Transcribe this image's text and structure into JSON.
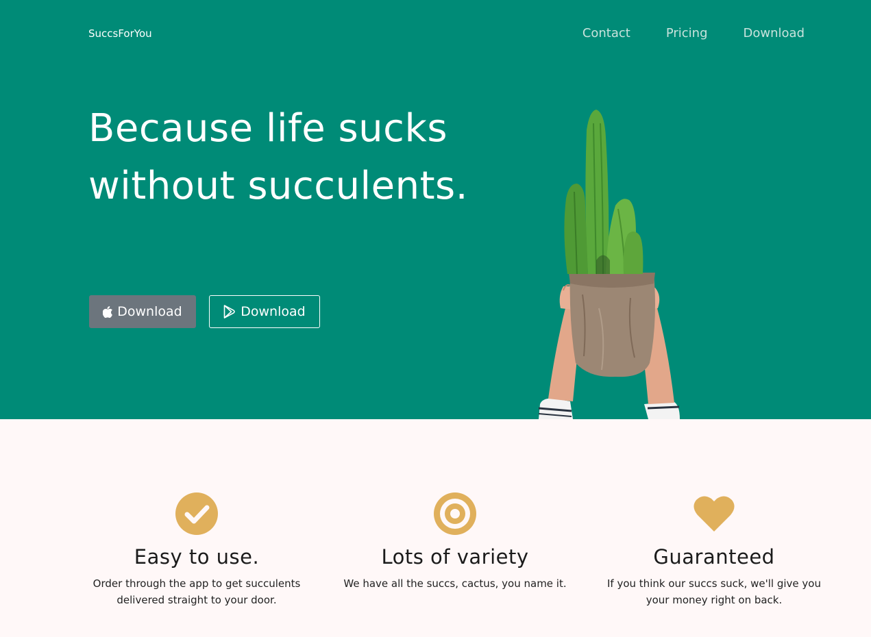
{
  "header": {
    "brand": "SuccsForYou",
    "nav": [
      {
        "label": "Contact"
      },
      {
        "label": "Pricing"
      },
      {
        "label": "Download"
      }
    ]
  },
  "hero": {
    "headline": "Because life sucks without succulents.",
    "buttons": [
      {
        "label": "Download",
        "icon": "apple-icon"
      },
      {
        "label": "Download",
        "icon": "google-play-icon"
      }
    ],
    "image": "cactus-in-paper-bag-held-by-hands"
  },
  "features": [
    {
      "icon": "check-circle-icon",
      "title": "Easy to use.",
      "text": "Order through the app to get succulents delivered straight to your door."
    },
    {
      "icon": "bullseye-icon",
      "title": "Lots of variety",
      "text": "We have all the succs, cactus, you name it."
    },
    {
      "icon": "heart-icon",
      "title": "Guaranteed",
      "text": "If you think our succs suck, we'll give you your money right on back."
    }
  ],
  "colors": {
    "hero_bg": "#008b77",
    "features_bg": "#fff8f8",
    "accent": "#e0b05c",
    "apple_button": "#6c757d"
  }
}
